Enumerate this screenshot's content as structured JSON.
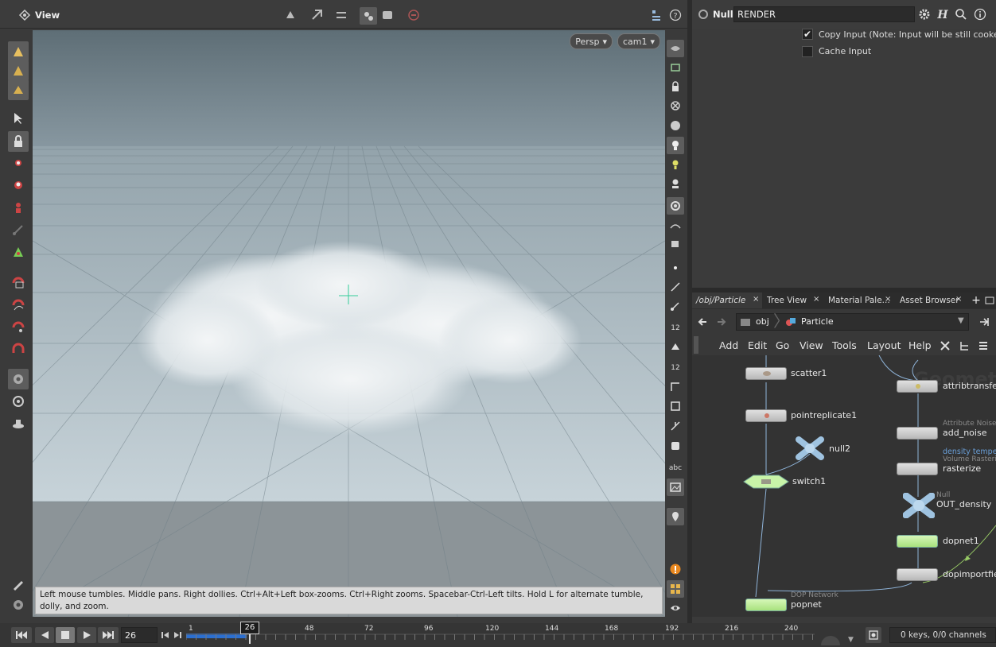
{
  "viewer": {
    "title": "View",
    "persp_label": "Persp",
    "camera_label": "cam1"
  },
  "viewport": {
    "status_text": "Left mouse tumbles. Middle pans. Right dollies. Ctrl+Alt+Left box-zooms. Ctrl+Right zooms. Spacebar-Ctrl-Left tilts. Hold L for alternate tumble, dolly, and zoom."
  },
  "params": {
    "node_type": "Null",
    "node_name": "RENDER",
    "copy_input_label": "Copy Input (Note: Input will be still cooked if c",
    "copy_input_checked": true,
    "cache_input_label": "Cache Input",
    "cache_input_checked": false
  },
  "network": {
    "tabs": [
      {
        "label": "/obj/Particle"
      },
      {
        "label": "Tree View"
      },
      {
        "label": "Material Pale..."
      },
      {
        "label": "Asset Browser"
      }
    ],
    "path": {
      "root": "obj",
      "current": "Particle"
    },
    "menu": [
      "Add",
      "Edit",
      "Go",
      "View",
      "Tools",
      "Layout",
      "Help"
    ],
    "watermark": "Geometry",
    "nodes": [
      {
        "name": "scatter1",
        "type": ""
      },
      {
        "name": "pointreplicate1",
        "type": ""
      },
      {
        "name": "null2",
        "type": ""
      },
      {
        "name": "switch1",
        "type": ""
      },
      {
        "name": "attribtransfer",
        "type": ""
      },
      {
        "name": "add_noise",
        "type": "Attribute Noise",
        "extra": "density tempera"
      },
      {
        "name": "rasterize",
        "type": "Volume Rasteriz"
      },
      {
        "name": "OUT_density",
        "type": "Null"
      },
      {
        "name": "dopnet1",
        "type": ""
      },
      {
        "name": "dopimportfiel",
        "type": ""
      },
      {
        "name": "popnet",
        "type": "DOP Network"
      }
    ]
  },
  "timeline": {
    "frame_value": "26",
    "current_frame_label": "26",
    "ticks": [
      "1",
      "48",
      "72",
      "96",
      "120",
      "144",
      "168",
      "192",
      "216",
      "240"
    ],
    "keys_status": "0 keys, 0/0 channels"
  },
  "icons": {
    "left_toolbar": [
      "brush-icon",
      "paint-icon",
      "sculpt-icon",
      "select-arrow-icon",
      "lock-icon",
      "handle-icon",
      "view-handle-icon",
      "pose-icon",
      "bone-icon",
      "tumble-icon",
      "snap-grid-icon",
      "snap-curve-icon",
      "snap-point-icon",
      "snap-magnet-icon",
      "render-region-icon",
      "camera-icon",
      "lights-icon",
      "note-icon",
      "settings-icon"
    ],
    "right_toolbar": [
      "display-options-icon",
      "ghost-icon",
      "lock-view-icon",
      "close-view-icon",
      "shading-icon",
      "light-icon",
      "headlight-icon",
      "scene-light-icon",
      "camera-view-icon",
      "background-icon",
      "visualizer-icon",
      "point-icon",
      "normal-icon",
      "vector-icon",
      "number-icon",
      "face-icon",
      "prim-number-icon",
      "uv-icon",
      "snapshot-icon",
      "grid-icon",
      "abc-icon",
      "image-icon",
      "marker-icon",
      "warning-icon",
      "layout-icon",
      "eye-icon"
    ]
  }
}
